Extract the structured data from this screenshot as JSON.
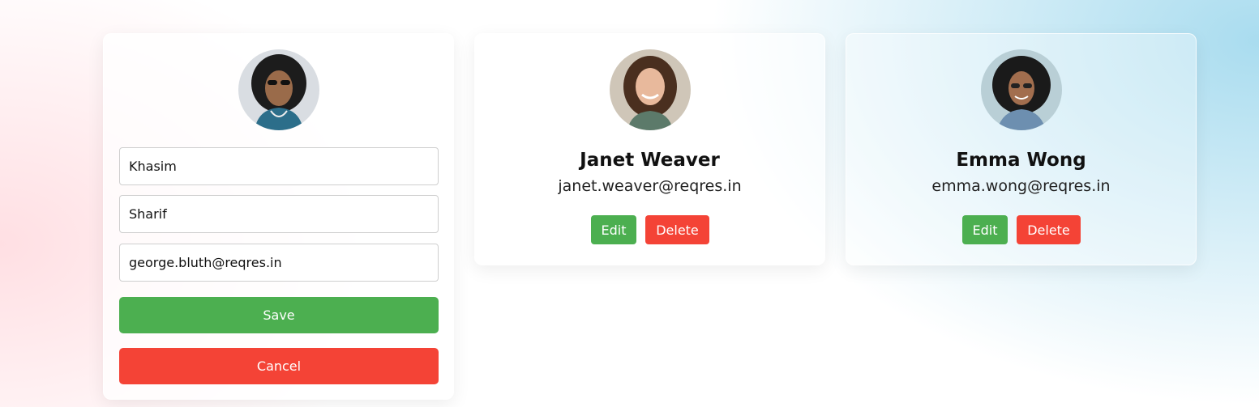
{
  "edit_form": {
    "first_name": "Khasim",
    "last_name": "Sharif",
    "email": "george.bluth@reqres.in",
    "save_label": "Save",
    "cancel_label": "Cancel"
  },
  "users": [
    {
      "name": "Janet Weaver",
      "email": "janet.weaver@reqres.in",
      "edit_label": "Edit",
      "delete_label": "Delete"
    },
    {
      "name": "Emma Wong",
      "email": "emma.wong@reqres.in",
      "edit_label": "Edit",
      "delete_label": "Delete"
    }
  ],
  "colors": {
    "save_green": "#4caf50",
    "delete_red": "#f44336"
  }
}
